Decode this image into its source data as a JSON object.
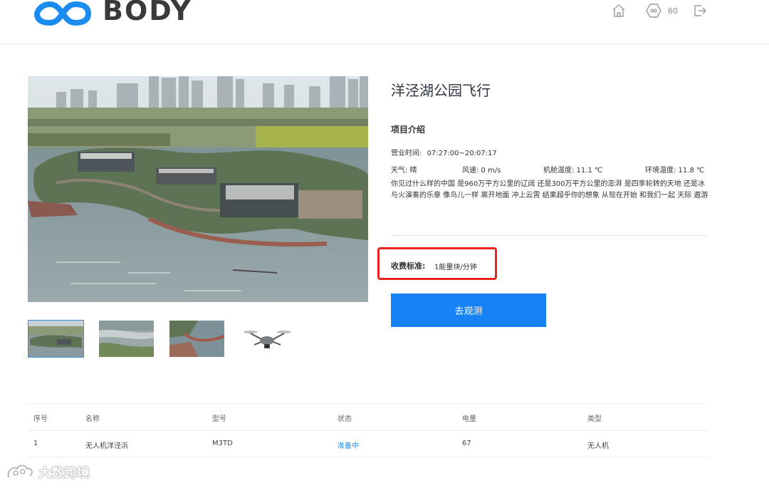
{
  "header": {
    "logo_text": "BODY",
    "energy_count": "60",
    "icons": [
      "home-icon",
      "energy-icon",
      "logout-icon"
    ],
    "brand_color": "#1a8cf0"
  },
  "gallery": {
    "main_image": "aerial photo of lakeside park with pavilion and city skyline",
    "thumbnails": [
      "aerial lakeside park",
      "river shoreline",
      "lake boardwalk",
      "drone"
    ]
  },
  "project": {
    "title": "洋泾湖公园飞行",
    "section_title": "项目介绍",
    "hours_label": "营业时间:",
    "hours_value": "07:27:00~20:07:17",
    "weather": "天气:  晴",
    "wind": "风速:  0 m/s",
    "cabin_temp": "机舱温度:  11.1 ℃",
    "env_temp": "环境温度:  11.8 ℃",
    "description": "你见过什么样的中国 是960万平方公里的辽阔 还是300万平方公里的澎湃 是四季轮转的天地 还是冰与火演奏的乐章 像鸟儿一样 离开地面 冲上云霄 结果超乎你的想象 从现在开始 和我们一起 天际 遨游",
    "fee_label": "收费标准:",
    "fee_value": "1能量块/分钟",
    "fee_highlight_color": "#e8231f",
    "go_button": "去观测"
  },
  "table": {
    "headers": [
      "序号",
      "名称",
      "型号",
      "状态",
      "电量",
      "类型"
    ],
    "rows": [
      [
        "1",
        "无人机洋泾浜",
        "M3TD",
        "准备中",
        "67",
        "无人机"
      ]
    ],
    "status_color": "#1a8cf0"
  },
  "watermark": {
    "text": "大数跨境"
  }
}
